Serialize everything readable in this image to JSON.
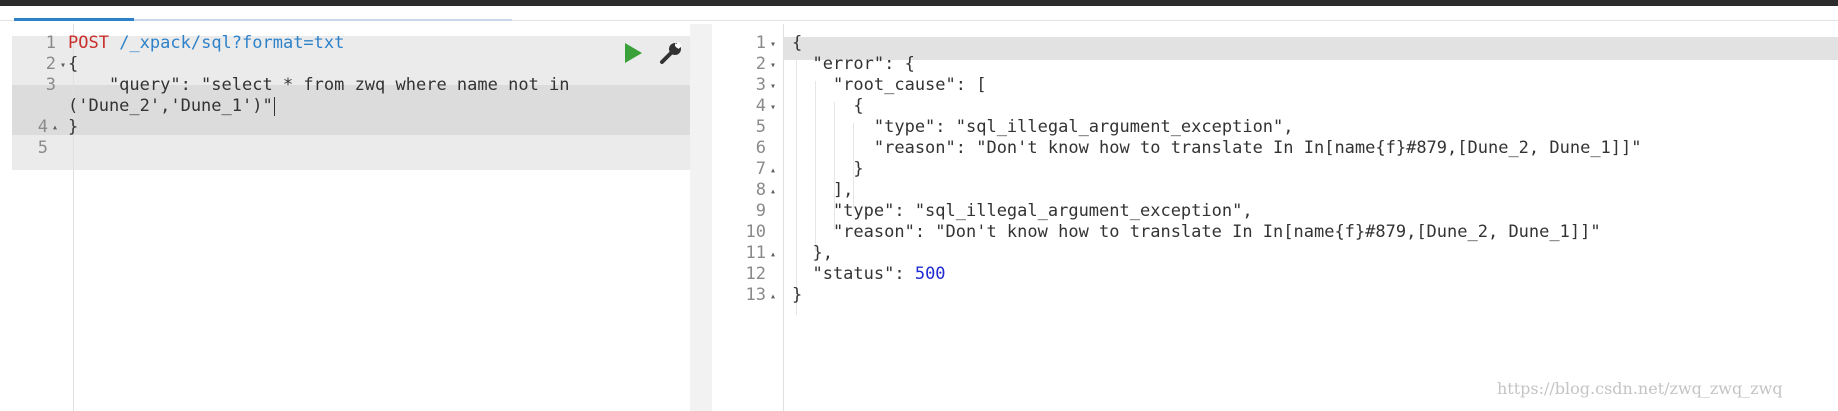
{
  "request_editor": {
    "lines": [
      {
        "no": "1",
        "fold": "",
        "method": "POST",
        "url": "/_xpack/sql?format=txt"
      },
      {
        "no": "2",
        "fold": "▾",
        "text": "{"
      },
      {
        "no": "3",
        "fold": "",
        "text": "    \"query\": \"select * from zwq where name not in"
      },
      {
        "no": "",
        "fold": "",
        "text": "('Dune_2','Dune_1')\""
      },
      {
        "no": "4",
        "fold": "▴",
        "text": "}"
      },
      {
        "no": "5",
        "fold": "",
        "text": ""
      }
    ],
    "play_icon": "play-icon",
    "wrench_icon": "wrench-icon"
  },
  "response_editor": {
    "lines": [
      {
        "no": "1",
        "fold": "▾",
        "text": "{"
      },
      {
        "no": "2",
        "fold": "▾",
        "text": "  \"error\": {"
      },
      {
        "no": "3",
        "fold": "▾",
        "text": "    \"root_cause\": ["
      },
      {
        "no": "4",
        "fold": "▾",
        "text": "      {"
      },
      {
        "no": "5",
        "fold": "",
        "text": "        \"type\": \"sql_illegal_argument_exception\","
      },
      {
        "no": "6",
        "fold": "",
        "text": "        \"reason\": \"Don't know how to translate In In[name{f}#879,[Dune_2, Dune_1]]\""
      },
      {
        "no": "7",
        "fold": "▴",
        "text": "      }"
      },
      {
        "no": "8",
        "fold": "▴",
        "text": "    ],"
      },
      {
        "no": "9",
        "fold": "",
        "text": "    \"type\": \"sql_illegal_argument_exception\","
      },
      {
        "no": "10",
        "fold": "",
        "text": "    \"reason\": \"Don't know how to translate In In[name{f}#879,[Dune_2, Dune_1]]\""
      },
      {
        "no": "11",
        "fold": "▴",
        "text": "  },"
      },
      {
        "no": "12",
        "fold": "",
        "key": "  \"status\": ",
        "value": "500"
      },
      {
        "no": "13",
        "fold": "▴",
        "text": "}"
      }
    ]
  },
  "watermark": "https://blog.csdn.net/zwq_zwq_zwq",
  "colors": {
    "method": "#c9302c",
    "url": "#2e82c9",
    "number": "#1f2bd1",
    "play": "#3aa03a",
    "active_tab": "#2e82c9"
  }
}
